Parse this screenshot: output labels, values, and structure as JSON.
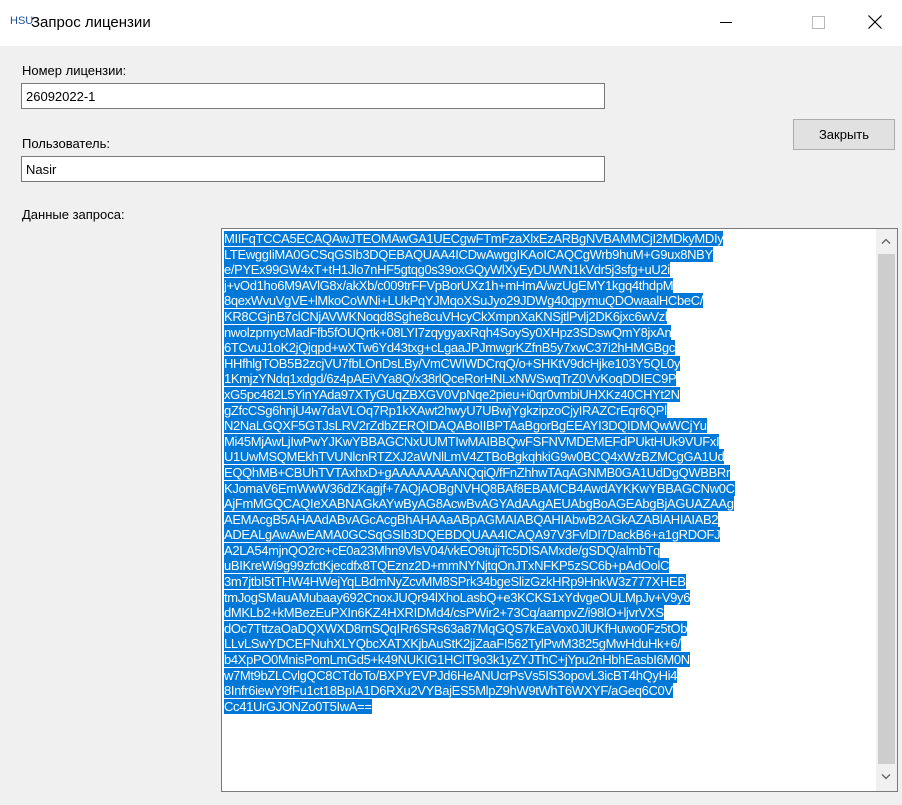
{
  "window": {
    "icon_text": "HSU",
    "title": "Запрос лицензии"
  },
  "form": {
    "license_label": "Номер лицензии:",
    "license_value": "26092022-1",
    "user_label": "Пользователь:",
    "user_value": "Nasir",
    "close_button": "Закрыть",
    "request_label": "Данные запроса:"
  },
  "request_data": {
    "lines": [
      "MIIFqTCCA5ECAQAwJTEOMAwGA1UECgwFTmFzaXlxEzARBgNVBAMMCjI2MDkyMDIy",
      "LTEwggIiMA0GCSqGSIb3DQEBAQUAA4ICDwAwggIKAoICAQCgWrb9huM+G9ux8NBY",
      "e/PYEx99GW4xT+tH1Jlo7nHF5gtqg0s39oxGQyWlXyEyDUWN1kVdr5j3sfg+uU2i",
      "j+vOd1ho6M9AVlG8x/akXb/c009trFFVpBorUXz1h+mHmA/wzUgEMY1kgq4thdpM",
      "8qexWvuVgVE+lMkoCoWNi+LUkPqYJMqoXSuJyo29JDWg40qpymuQDOwaalHCbeC/",
      "KR8CGjnB7clCNjAVWKNoqd8Sghe8cuVHcyCkXmpnXaKNSjtlPvlj2DK6jxc6wVzl",
      "nwolzpmycMadFfb5fOUQrtk+08LYI7zqygyaxRqh4SoySy0XHpz3SDswQmY8jxAn",
      "6TCvuJ1oK2jQjqpd+wXTw6Yd43txg+cLgaaJPJmwgrKZfnB5y7xwC37i2hHMGBgc",
      "HHfhlgTOB5B2zcjVU7fbLOnDsLBy/VmCWIWDCrqQ/o+SHKtV9dcHjke103Y5QL0y",
      "1KmjzYNdq1xdgd/6z4pAEiVYa8Q/x38rlQceRorHNLxNWSwqTrZ0VvKoqDDIEC9P",
      "xG5pc482L5YinYAda97XTyGUqZBXGV0VpNqe2pieu+i0qr0vmbiUHXKz40CHYt2N",
      "gZfcCSg6hnjU4w7daVLOq7Rp1kXAwt2hwyU7UBwjYgkzipzoCjyIRAZCrEqr6QPl",
      "N2NaLGQXF5GTJsLRV2rZdbZERQIDAQABoIIBPTAaBgorBgEEAYI3DQIDMQwWCjYu",
      "Mi45MjAwLjIwPwYJKwYBBAGCNxUUMTIwMAIBBQwFSFNVMDEMEFdPUktHUk9VUFxI",
      "U1UwMSQMEkhTVUNlcnRTZXJ2aWNlLmV4ZTBoBgkqhkiG9w0BCQ4xWzBZMCgGA1Ud",
      "EQQhMB+CBUhTVTAxhxD+gAAAAAAAANQqiQ/fFnZhhwTAqAGNMB0GA1UdDgQWBBRr",
      "KJomaV6EmWwW36dZKagjf+7AQjAOBgNVHQ8BAf8EBAMCB4AwdAYKKwYBBAGCNw0C",
      "AjFmMGQCAQIeXABNAGkAYwByAG8AcwBvAGYAdAAgAEUAbgBoAGEAbgBjAGUAZAAg",
      "AEMAcgB5AHAAdABvAGcAcgBhAHAAaABpAGMAIABQAHIAbwB2AGkAZABlAHIAIAB2",
      "ADEALgAwAwEAMA0GCSqGSIb3DQEBDQUAA4ICAQA97V3FvlDI7DackB6+a1gRDOFJ",
      "A2LA54mjnQO2rc+cE0a23Mhn9VlsV04/vkEO9tujiTc5DISAMxde/gSDQ/almbTq",
      "uBIKreWi9g99zfctKjecdfx8TQEznz2D+mmNYNjtqOnJTxNFKP5zSC6b+pAdOolC",
      "3m7jtbI5tTHW4HWejYqLBdmNyZcvMM8SPrk34bgeSlizGzkHRp9HnkW3z777XHEB",
      "tmJogSMauAMubaay692CnoxJUQr94lXhoLasbQ+e3KCKS1xYdvgeOULMpJv+V9y6",
      "dMKLb2+kMBezEuPXIn6KZ4HXRIDMd4/csPWir2+73Cq/aampvZ/i98lO+ljvrVXS",
      "dOc7TttzaOaDQXWXD8rnSQqIRr6SRs63a87MqGQS7kEaVox0JlUKfHuwo0Fz5tOb",
      "LLvLSwYDCEFNuhXLYQbcXATXKjbAuStK2jjZaaFI562TylPwM3825gMwHduHk+6/",
      "b4XpPO0MnisPomLmGd5+k49NUKIG1HClT9o3k1yZYJThC+jYpu2nHbhEasbI6M0N",
      "w7Mt9bZLCvlgQC8CTdoTo/BXPYEVPJd6HeANUcrPsVs5IS3opovL3icBT4hQyHi4",
      "8Infr6iewY9fFu1ct18BpIA1D6RXu2VYBajES5MlpZ9hW9tWhT6WXYF/aGeq6C0V",
      "Cc41UrGJONZo0T5IwA=="
    ]
  },
  "colors": {
    "selection": "#0078d7",
    "window_bg": "#f0f0f0"
  }
}
